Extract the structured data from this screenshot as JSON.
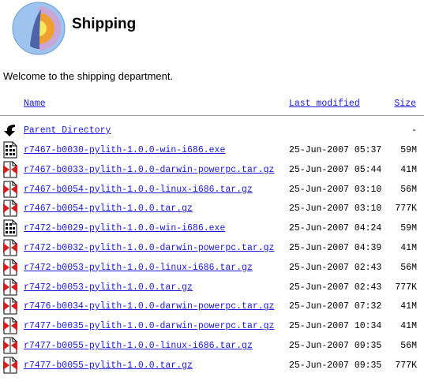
{
  "page": {
    "title": "Shipping",
    "welcome": "Welcome to the shipping department."
  },
  "columns": {
    "name": "Name",
    "last_modified": "Last modified",
    "size": "Size"
  },
  "parent": {
    "label": "Parent Directory",
    "size": "-"
  },
  "files": [
    {
      "name": "r7467-b0030-pylith-1.0.0-win-i686.exe",
      "date": "25-Jun-2007 05:37",
      "size": "59M",
      "icon": "binary-icon"
    },
    {
      "name": "r7467-b0033-pylith-1.0.0-darwin-powerpc.tar.gz",
      "date": "25-Jun-2007 05:44",
      "size": "41M",
      "icon": "compressed-icon"
    },
    {
      "name": "r7467-b0054-pylith-1.0.0-linux-i686.tar.gz",
      "date": "25-Jun-2007 03:10",
      "size": "56M",
      "icon": "compressed-icon"
    },
    {
      "name": "r7467-b0054-pylith-1.0.0.tar.gz",
      "date": "25-Jun-2007 03:10",
      "size": "777K",
      "icon": "compressed-icon"
    },
    {
      "name": "r7472-b0029-pylith-1.0.0-win-i686.exe",
      "date": "25-Jun-2007 04:24",
      "size": "59M",
      "icon": "binary-icon"
    },
    {
      "name": "r7472-b0032-pylith-1.0.0-darwin-powerpc.tar.gz",
      "date": "25-Jun-2007 04:39",
      "size": "41M",
      "icon": "compressed-icon"
    },
    {
      "name": "r7472-b0053-pylith-1.0.0-linux-i686.tar.gz",
      "date": "25-Jun-2007 02:43",
      "size": "56M",
      "icon": "compressed-icon"
    },
    {
      "name": "r7472-b0053-pylith-1.0.0.tar.gz",
      "date": "25-Jun-2007 02:43",
      "size": "777K",
      "icon": "compressed-icon"
    },
    {
      "name": "r7476-b0034-pylith-1.0.0-darwin-powerpc.tar.gz",
      "date": "25-Jun-2007 07:32",
      "size": "41M",
      "icon": "compressed-icon"
    },
    {
      "name": "r7477-b0035-pylith-1.0.0-darwin-powerpc.tar.gz",
      "date": "25-Jun-2007 10:34",
      "size": "41M",
      "icon": "compressed-icon"
    },
    {
      "name": "r7477-b0055-pylith-1.0.0-linux-i686.tar.gz",
      "date": "25-Jun-2007 09:35",
      "size": "56M",
      "icon": "compressed-icon"
    },
    {
      "name": "r7477-b0055-pylith-1.0.0.tar.gz",
      "date": "25-Jun-2007 09:35",
      "size": "777K",
      "icon": "compressed-icon"
    }
  ],
  "colors": {
    "link": "#1a1ad8",
    "logo_outer": "#8fb8e8",
    "logo_mantle": "#c9a6d8",
    "logo_core": "#f0b030",
    "logo_inner": "#f6e860",
    "icon_red": "#d02020"
  }
}
